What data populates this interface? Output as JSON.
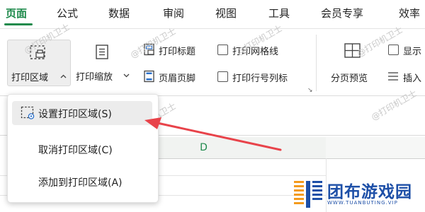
{
  "menu": {
    "tabs": [
      {
        "label": "页面",
        "active": true
      },
      {
        "label": "公式"
      },
      {
        "label": "数据"
      },
      {
        "label": "审阅"
      },
      {
        "label": "视图"
      },
      {
        "label": "工具"
      },
      {
        "label": "会员专享"
      },
      {
        "label": "效率"
      }
    ]
  },
  "ribbon": {
    "print_area": {
      "label": "打印区域"
    },
    "print_scale": {
      "label": "打印缩放"
    },
    "print_titles": {
      "label": "打印标题"
    },
    "header_footer": {
      "label": "页眉页脚"
    },
    "print_gridlines": {
      "label": "打印网格线",
      "checked": false
    },
    "print_row_col_headings": {
      "label": "打印行号列标",
      "checked": false
    },
    "page_break_preview": {
      "label": "分页预览"
    },
    "show": {
      "label": "显示",
      "checked": false
    },
    "insert": {
      "label": "插入"
    }
  },
  "dropdown": {
    "items": [
      {
        "label": "设置打印区域(S)",
        "highlighted": true
      },
      {
        "label": "取消打印区域(C)"
      },
      {
        "label": "添加到打印区域(A)"
      }
    ]
  },
  "sheet": {
    "column_header": "D"
  },
  "watermark": {
    "text": "@打印机卫士"
  },
  "logo": {
    "name": "团布游戏园",
    "url": "WWW.TUANBUTING.VIP"
  },
  "colors": {
    "accent": "#1f8a4c",
    "arrow": "#e8434a",
    "logo_blue": "#1d4fa7",
    "logo_orange": "#f39a1d"
  }
}
